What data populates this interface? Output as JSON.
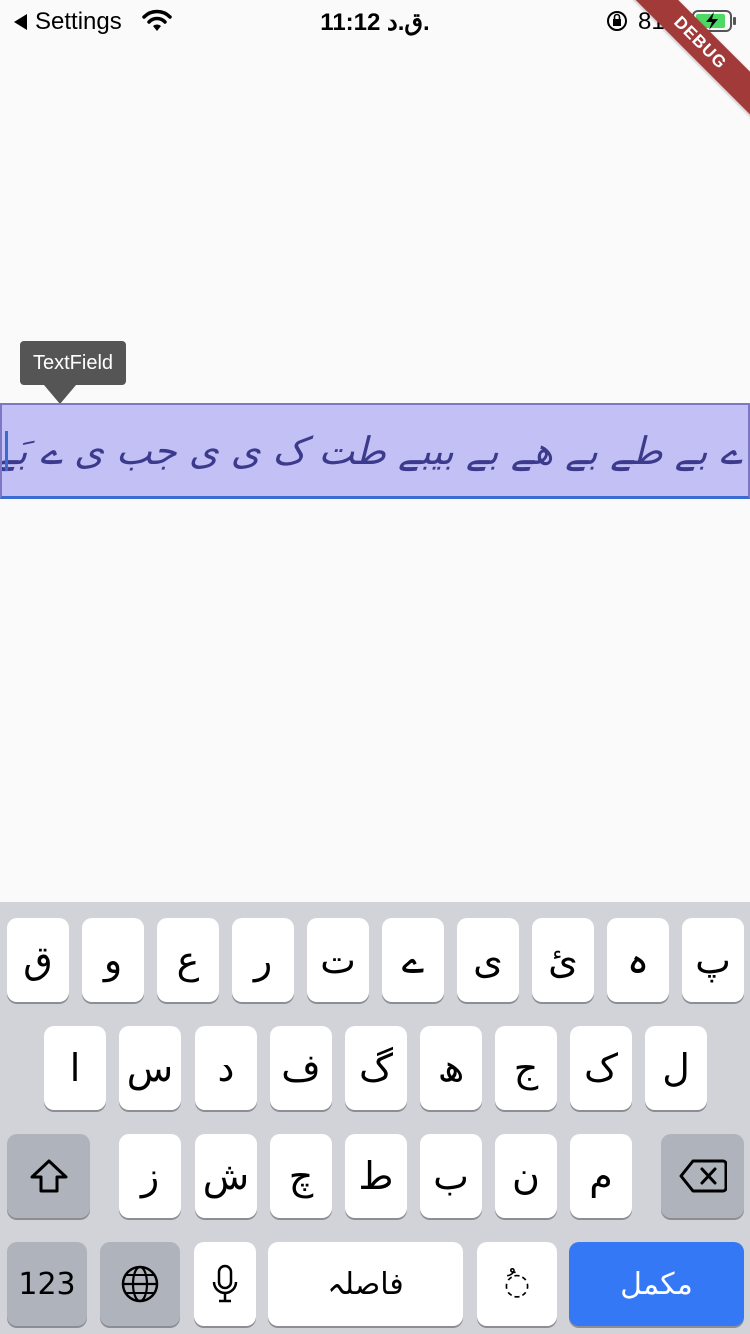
{
  "status_bar": {
    "back_label": "Settings",
    "time": "11:12 ق.د.",
    "battery_percent": "81%",
    "debug_label": "DEBUG"
  },
  "tooltip": {
    "label": "TextField"
  },
  "textfield": {
    "value": "ے بے طے بے ھے بے بیبے طت ک ی ی جب ی ے بَے بے ب"
  },
  "keyboard": {
    "row1": [
      "پ",
      "ہ",
      "ئ",
      "ی",
      "ے",
      "ت",
      "ر",
      "ع",
      "و",
      "ق"
    ],
    "row2": [
      "ل",
      "ک",
      "ج",
      "ھ",
      "گ",
      "ف",
      "د",
      "س",
      "ا"
    ],
    "row3": [
      "م",
      "ن",
      "ب",
      "ط",
      "چ",
      "ش",
      "ز"
    ],
    "numbers_label": "123",
    "space_label": "فاصلہ",
    "diacritic_label": "ُ◌",
    "done_label": "مکمل",
    "shift_icon": "shift-icon",
    "delete_icon": "delete-icon",
    "globe_icon": "globe-icon",
    "mic_icon": "microphone-icon"
  },
  "colors": {
    "textfield_bg": "#c2c0f4",
    "done_key": "#3478f6",
    "keyboard_bg": "#d2d3d8"
  }
}
